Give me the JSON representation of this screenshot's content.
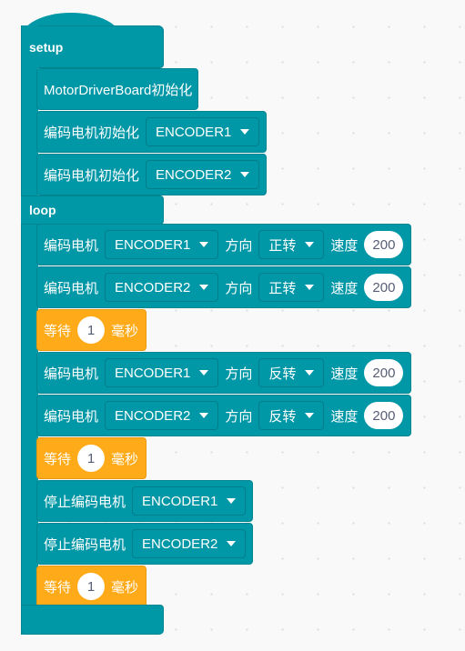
{
  "colors": {
    "motor": "#0097a7",
    "control": "#ffab19"
  },
  "setup_label": "setup",
  "loop_label": "loop",
  "setup_blocks": [
    {
      "type": "text",
      "text": "MotorDriverBoard初始化"
    },
    {
      "type": "init",
      "text": "编码电机初始化",
      "encoder": "ENCODER1"
    },
    {
      "type": "init",
      "text": "编码电机初始化",
      "encoder": "ENCODER2"
    }
  ],
  "loop_blocks": [
    {
      "type": "motor",
      "text": "编码电机",
      "encoder": "ENCODER1",
      "dir_label": "方向",
      "dir": "正转",
      "speed_label": "速度",
      "speed": "200"
    },
    {
      "type": "motor",
      "text": "编码电机",
      "encoder": "ENCODER2",
      "dir_label": "方向",
      "dir": "正转",
      "speed_label": "速度",
      "speed": "200"
    },
    {
      "type": "wait",
      "text": "等待",
      "value": "1",
      "unit": "毫秒"
    },
    {
      "type": "motor",
      "text": "编码电机",
      "encoder": "ENCODER1",
      "dir_label": "方向",
      "dir": "反转",
      "speed_label": "速度",
      "speed": "200"
    },
    {
      "type": "motor",
      "text": "编码电机",
      "encoder": "ENCODER2",
      "dir_label": "方向",
      "dir": "反转",
      "speed_label": "速度",
      "speed": "200"
    },
    {
      "type": "wait",
      "text": "等待",
      "value": "1",
      "unit": "毫秒"
    },
    {
      "type": "stop",
      "text": "停止编码电机",
      "encoder": "ENCODER1"
    },
    {
      "type": "stop",
      "text": "停止编码电机",
      "encoder": "ENCODER2"
    },
    {
      "type": "wait",
      "text": "等待",
      "value": "1",
      "unit": "毫秒"
    }
  ]
}
